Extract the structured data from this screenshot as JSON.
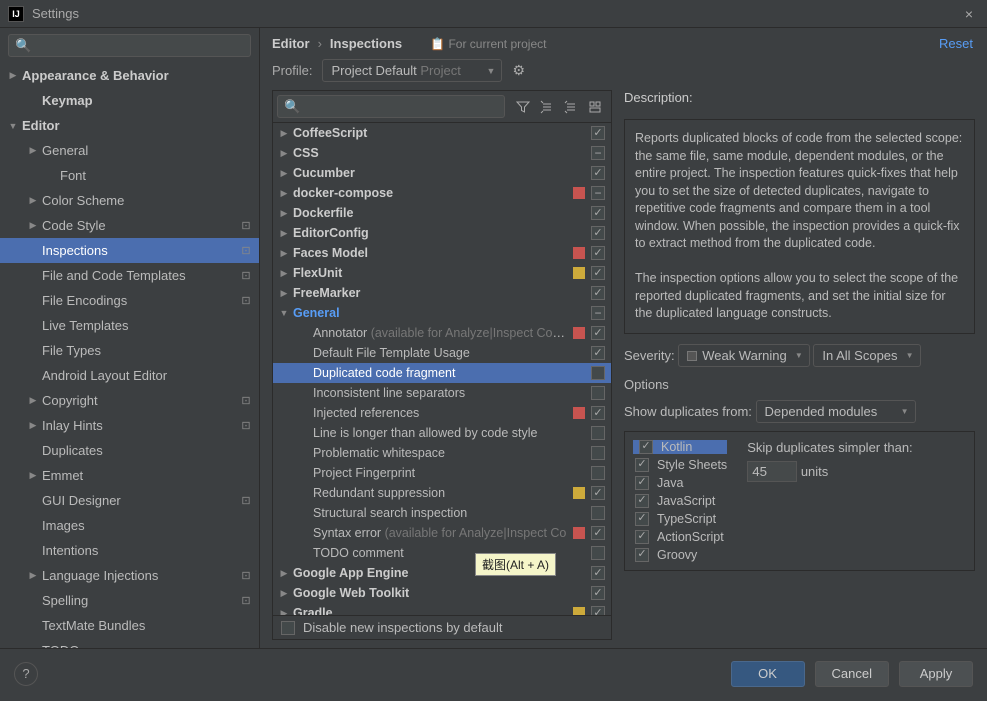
{
  "window": {
    "title": "Settings",
    "close": "×"
  },
  "sidebar_search_placeholder": "",
  "sidebar": [
    {
      "label": "Appearance & Behavior",
      "arrow": "collapsed",
      "indent": 0,
      "bold": true
    },
    {
      "label": "Keymap",
      "arrow": "none",
      "indent": 1,
      "bold": true
    },
    {
      "label": "Editor",
      "arrow": "expanded",
      "indent": 0,
      "bold": true
    },
    {
      "label": "General",
      "arrow": "collapsed",
      "indent": 1
    },
    {
      "label": "Font",
      "arrow": "none",
      "indent": 2
    },
    {
      "label": "Color Scheme",
      "arrow": "collapsed",
      "indent": 1
    },
    {
      "label": "Code Style",
      "arrow": "collapsed",
      "indent": 1,
      "badge": true
    },
    {
      "label": "Inspections",
      "arrow": "none",
      "indent": 1,
      "badge": true,
      "selected": true
    },
    {
      "label": "File and Code Templates",
      "arrow": "none",
      "indent": 1,
      "badge": true
    },
    {
      "label": "File Encodings",
      "arrow": "none",
      "indent": 1,
      "badge": true
    },
    {
      "label": "Live Templates",
      "arrow": "none",
      "indent": 1
    },
    {
      "label": "File Types",
      "arrow": "none",
      "indent": 1
    },
    {
      "label": "Android Layout Editor",
      "arrow": "none",
      "indent": 1
    },
    {
      "label": "Copyright",
      "arrow": "collapsed",
      "indent": 1,
      "badge": true
    },
    {
      "label": "Inlay Hints",
      "arrow": "collapsed",
      "indent": 1,
      "badge": true
    },
    {
      "label": "Duplicates",
      "arrow": "none",
      "indent": 1
    },
    {
      "label": "Emmet",
      "arrow": "collapsed",
      "indent": 1
    },
    {
      "label": "GUI Designer",
      "arrow": "none",
      "indent": 1,
      "badge": true
    },
    {
      "label": "Images",
      "arrow": "none",
      "indent": 1
    },
    {
      "label": "Intentions",
      "arrow": "none",
      "indent": 1
    },
    {
      "label": "Language Injections",
      "arrow": "collapsed",
      "indent": 1,
      "badge": true
    },
    {
      "label": "Spelling",
      "arrow": "none",
      "indent": 1,
      "badge": true
    },
    {
      "label": "TextMate Bundles",
      "arrow": "none",
      "indent": 1
    },
    {
      "label": "TODO",
      "arrow": "none",
      "indent": 1
    }
  ],
  "breadcrumb": {
    "a": "Editor",
    "b": "Inspections"
  },
  "for_project": "For current project",
  "reset": "Reset",
  "profile_label": "Profile:",
  "profile_value": "Project Default",
  "profile_dim": "Project",
  "insp_search_placeholder": "",
  "insp_tree": [
    {
      "label": "CoffeeScript",
      "arrow": "collapsed",
      "indent": 0,
      "bold": true,
      "mark": "none",
      "check": "checked"
    },
    {
      "label": "CSS",
      "arrow": "collapsed",
      "indent": 0,
      "bold": true,
      "mark": "none",
      "check": "mixed"
    },
    {
      "label": "Cucumber",
      "arrow": "collapsed",
      "indent": 0,
      "bold": true,
      "mark": "none",
      "check": "checked"
    },
    {
      "label": "docker-compose",
      "arrow": "collapsed",
      "indent": 0,
      "bold": true,
      "mark": "red",
      "check": "mixed"
    },
    {
      "label": "Dockerfile",
      "arrow": "collapsed",
      "indent": 0,
      "bold": true,
      "mark": "none",
      "check": "checked"
    },
    {
      "label": "EditorConfig",
      "arrow": "collapsed",
      "indent": 0,
      "bold": true,
      "mark": "none",
      "check": "checked"
    },
    {
      "label": "Faces Model",
      "arrow": "collapsed",
      "indent": 0,
      "bold": true,
      "mark": "red",
      "check": "checked"
    },
    {
      "label": "FlexUnit",
      "arrow": "collapsed",
      "indent": 0,
      "bold": true,
      "mark": "yellow",
      "check": "checked"
    },
    {
      "label": "FreeMarker",
      "arrow": "collapsed",
      "indent": 0,
      "bold": true,
      "mark": "none",
      "check": "checked"
    },
    {
      "label": "General",
      "arrow": "expanded",
      "indent": 0,
      "blue": true,
      "mark": "none",
      "check": "mixed"
    },
    {
      "label": "Annotator",
      "avail": "(available for Analyze|Inspect Code)",
      "arrow": "none",
      "indent": 1,
      "mark": "red",
      "check": "checked"
    },
    {
      "label": "Default File Template Usage",
      "arrow": "none",
      "indent": 1,
      "mark": "none",
      "check": "checked"
    },
    {
      "label": "Duplicated code fragment",
      "arrow": "none",
      "indent": 1,
      "mark": "none",
      "check": "none",
      "selected": true
    },
    {
      "label": "Inconsistent line separators",
      "arrow": "none",
      "indent": 1,
      "mark": "none",
      "check": "none"
    },
    {
      "label": "Injected references",
      "arrow": "none",
      "indent": 1,
      "mark": "red",
      "check": "checked"
    },
    {
      "label": "Line is longer than allowed by code style",
      "arrow": "none",
      "indent": 1,
      "mark": "none",
      "check": "none"
    },
    {
      "label": "Problematic whitespace",
      "arrow": "none",
      "indent": 1,
      "mark": "none",
      "check": "none"
    },
    {
      "label": "Project Fingerprint",
      "arrow": "none",
      "indent": 1,
      "mark": "none",
      "check": "none"
    },
    {
      "label": "Redundant suppression",
      "arrow": "none",
      "indent": 1,
      "mark": "yellow",
      "check": "checked"
    },
    {
      "label": "Structural search inspection",
      "arrow": "none",
      "indent": 1,
      "mark": "none",
      "check": "none"
    },
    {
      "label": "Syntax error",
      "avail": "(available for Analyze|Inspect Co",
      "arrow": "none",
      "indent": 1,
      "mark": "red",
      "check": "checked"
    },
    {
      "label": "TODO comment",
      "arrow": "none",
      "indent": 1,
      "mark": "none",
      "check": "none"
    },
    {
      "label": "Google App Engine",
      "arrow": "collapsed",
      "indent": 0,
      "bold": true,
      "mark": "none",
      "check": "checked"
    },
    {
      "label": "Google Web Toolkit",
      "arrow": "collapsed",
      "indent": 0,
      "bold": true,
      "mark": "none",
      "check": "checked"
    },
    {
      "label": "Gradle",
      "arrow": "collapsed",
      "indent": 0,
      "bold": true,
      "mark": "yellow",
      "check": "checked"
    }
  ],
  "disable_new": "Disable new inspections by default",
  "desc_title": "Description:",
  "desc_body1": "Reports duplicated blocks of code from the selected scope: the same file, same module, dependent modules, or the entire project. The inspection features quick-fixes that help you to set the size of detected duplicates, navigate to repetitive code fragments and compare them in a tool window. When possible, the inspection provides a quick-fix to extract method from the duplicated code.",
  "desc_body2": "The inspection options allow you to select the scope of the reported duplicated fragments, and set the initial size for the duplicated language constructs.",
  "severity_label": "Severity:",
  "severity_value": "Weak Warning",
  "scope_value": "In All Scopes",
  "options_label": "Options",
  "show_dup_label": "Show duplicates from:",
  "show_dup_value": "Depended modules",
  "skip_label": "Skip duplicates simpler than:",
  "units": "units",
  "skip_value": "45",
  "langs": [
    {
      "label": "Kotlin",
      "checked": true,
      "sel": true
    },
    {
      "label": "Style Sheets",
      "checked": true
    },
    {
      "label": "Java",
      "checked": true
    },
    {
      "label": "JavaScript",
      "checked": true
    },
    {
      "label": "TypeScript",
      "checked": true
    },
    {
      "label": "ActionScript",
      "checked": true
    },
    {
      "label": "Groovy",
      "checked": true
    }
  ],
  "tooltip": "截图(Alt + A)",
  "footer": {
    "ok": "OK",
    "cancel": "Cancel",
    "apply": "Apply",
    "help": "?"
  }
}
